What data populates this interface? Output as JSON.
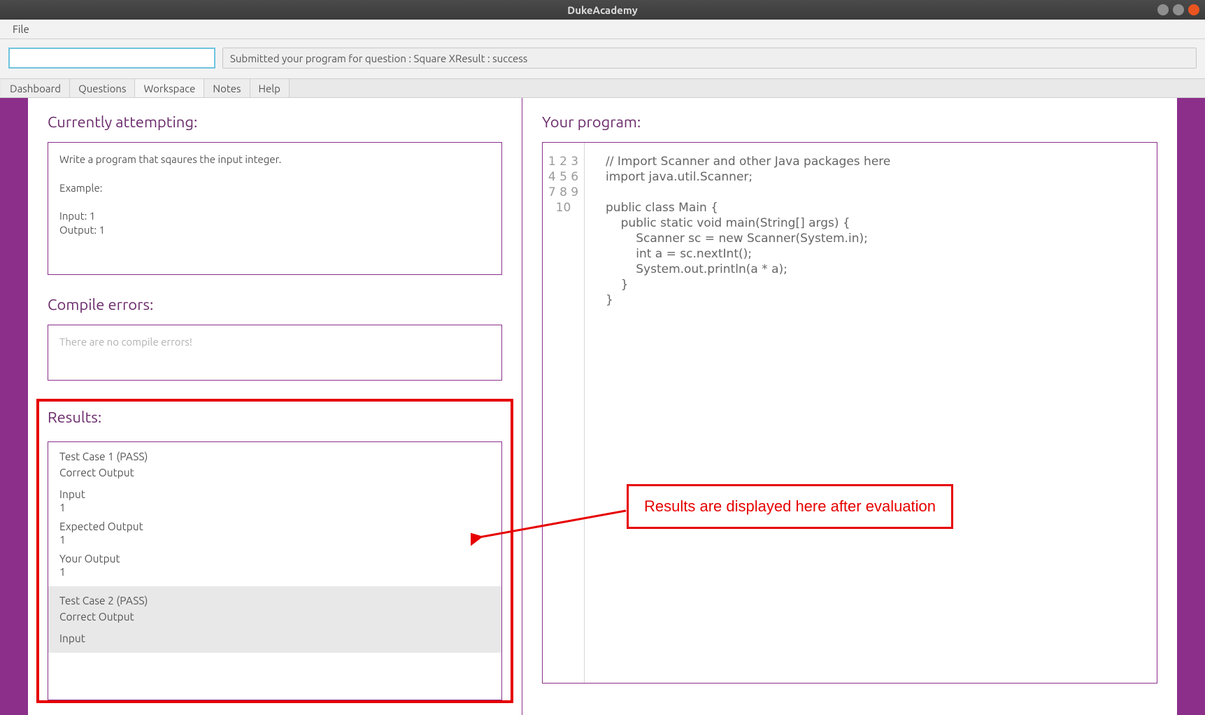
{
  "window": {
    "title": "DukeAcademy"
  },
  "menubar": {
    "items": [
      "File"
    ]
  },
  "command_input": {
    "value": "",
    "placeholder": ""
  },
  "status": {
    "text": "Submitted your program for question : Square XResult : success"
  },
  "tabs": [
    "Dashboard",
    "Questions",
    "Workspace",
    "Notes",
    "Help"
  ],
  "active_tab": "Workspace",
  "left": {
    "attempting_title": "Currently attempting:",
    "problem_text": "Write a program that sqaures the input integer.\n\nExample:\n\nInput: 1\nOutput: 1",
    "compile_title": "Compile errors:",
    "compile_text": "There are no compile errors!",
    "results_title": "Results:",
    "testcases": [
      {
        "head": "Test Case 1   (PASS)",
        "sub": "Correct Output",
        "input_label": "Input",
        "input": "1",
        "expected_label": "Expected Output",
        "expected": "1",
        "your_label": "Your Output",
        "your": "1"
      },
      {
        "head": "Test Case 2   (PASS)",
        "sub": "Correct Output",
        "input_label": "Input",
        "input": "",
        "expected_label": "",
        "expected": "",
        "your_label": "",
        "your": ""
      }
    ]
  },
  "right": {
    "program_title": "Your program:",
    "code_lines": [
      "// Import Scanner and other Java packages here",
      "import java.util.Scanner;",
      "",
      "public class Main {",
      "    public static void main(String[] args) {",
      "        Scanner sc = new Scanner(System.in);",
      "        int a = sc.nextInt();",
      "        System.out.println(a * a);",
      "    }",
      "}"
    ]
  },
  "annotation": {
    "text": "Results are displayed here after evaluation"
  }
}
